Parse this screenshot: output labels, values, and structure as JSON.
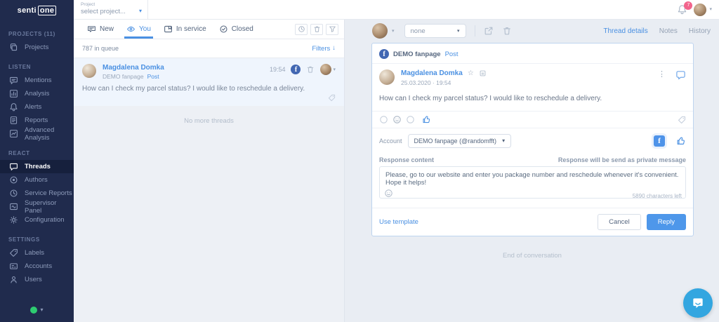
{
  "app": {
    "logo_senti": "senti",
    "logo_one": "one"
  },
  "topbar": {
    "project_label": "Project",
    "project_value": "select project...",
    "notification_count": "7"
  },
  "sidebar": {
    "sections": [
      {
        "header": "PROJECTS (11)",
        "items": [
          {
            "label": "Projects"
          }
        ]
      },
      {
        "header": "LISTEN",
        "items": [
          {
            "label": "Mentions"
          },
          {
            "label": "Analysis"
          },
          {
            "label": "Alerts"
          },
          {
            "label": "Reports"
          },
          {
            "label": "Advanced Analysis"
          }
        ]
      },
      {
        "header": "REACT",
        "items": [
          {
            "label": "Threads",
            "active": true
          },
          {
            "label": "Authors"
          },
          {
            "label": "Service Reports"
          },
          {
            "label": "Supervisor Panel"
          },
          {
            "label": "Configuration"
          }
        ]
      },
      {
        "header": "SETTINGS",
        "items": [
          {
            "label": "Labels"
          },
          {
            "label": "Accounts"
          },
          {
            "label": "Users"
          }
        ]
      }
    ]
  },
  "thread_list": {
    "tabs": [
      {
        "label": "New"
      },
      {
        "label": "You"
      },
      {
        "label": "In service"
      },
      {
        "label": "Closed"
      }
    ],
    "queue_count": "787 in queue",
    "filters_label": "Filters",
    "thread": {
      "author": "Magdalena Domka",
      "source": "DEMO fanpage",
      "post_type": "Post",
      "time": "19:54",
      "message": "How can I check my parcel status? I would like to reschedule a delivery."
    },
    "empty_text": "No more threads"
  },
  "conversation": {
    "assign_value": "none",
    "tabs": [
      {
        "label": "Thread details"
      },
      {
        "label": "Notes"
      },
      {
        "label": "History"
      }
    ],
    "card": {
      "page_name": "DEMO fanpage",
      "post_type": "Post",
      "author": "Magdalena Domka",
      "datetime": "25.03.2020  ·  19:54",
      "message": "How can I check my parcel status? I would like to reschedule a delivery.",
      "account_label": "Account",
      "account_value": "DEMO fanpage (@randomfft)",
      "response_label": "Response content",
      "response_hint": "Response will be send as private message",
      "response_text": "Please, go to our website and enter you package number and reschedule whenever it's convenient. Hope it helps!",
      "chars_left": "5890 characters left",
      "use_template_label": "Use template",
      "cancel_label": "Cancel",
      "reply_label": "Reply"
    },
    "end_text": "End of conversation"
  },
  "colors": {
    "accent": "#4a90e2",
    "sidebar_bg": "#202b4d",
    "badge": "#f2648c",
    "fab": "#33a6e0"
  }
}
